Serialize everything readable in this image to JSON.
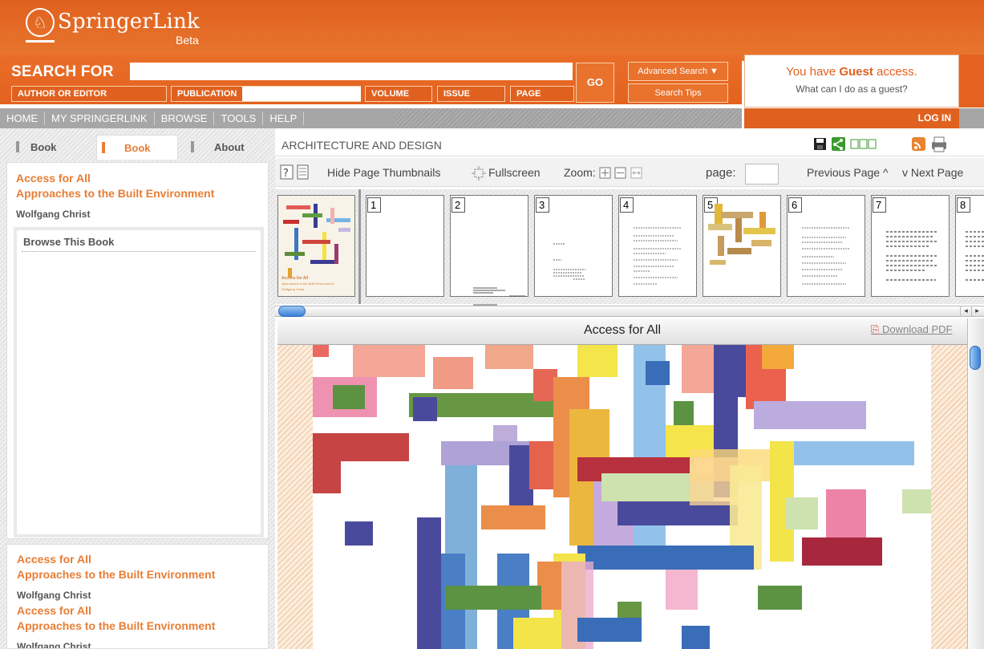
{
  "header": {
    "brand": "SpringerLink",
    "beta": "Beta"
  },
  "search": {
    "label": "SEARCH FOR",
    "go": "GO",
    "advanced": "Advanced Search ▼",
    "tips": "Search Tips",
    "fields": [
      "AUTHOR OR EDITOR",
      "PUBLICATION",
      "VOLUME",
      "ISSUE",
      "PAGE"
    ]
  },
  "guest": {
    "prefix": "You have ",
    "bold": "Guest",
    "suffix": " access.",
    "question": "What can I do as a guest?"
  },
  "nav": {
    "items": [
      "HOME",
      "MY SPRINGERLINK",
      "BROWSE",
      "TOOLS",
      "HELP"
    ],
    "login": "LOG IN"
  },
  "sidebar": {
    "tabs": [
      "Book",
      "Book",
      "About"
    ],
    "book": {
      "title": "Access for All",
      "subtitle": "Approaches to the Built Environment",
      "author": "Wolfgang Christ"
    },
    "browse_title": "Browse This Book"
  },
  "main": {
    "breadcrumb": "ARCHITECTURE AND DESIGN",
    "toolbar": {
      "hide_thumbs": "Hide Page Thumbnails",
      "fullscreen": "Fullscreen",
      "zoom": "Zoom:",
      "page_label": "page:",
      "prev": "Previous Page",
      "next": "Next Page"
    },
    "thumbnail_numbers": [
      "1",
      "2",
      "3",
      "4",
      "5",
      "6",
      "7",
      "8"
    ],
    "doc_title": "Access for All",
    "download": "Download PDF"
  },
  "cover": {
    "title": "Access for All",
    "subtitle": "Approaches to the Built Environment",
    "author": "Wolfgang Christ"
  },
  "colors": {
    "brand_orange": "#e0611f",
    "link_orange": "#e87d35",
    "nav_gray": "#a6a6a6"
  }
}
